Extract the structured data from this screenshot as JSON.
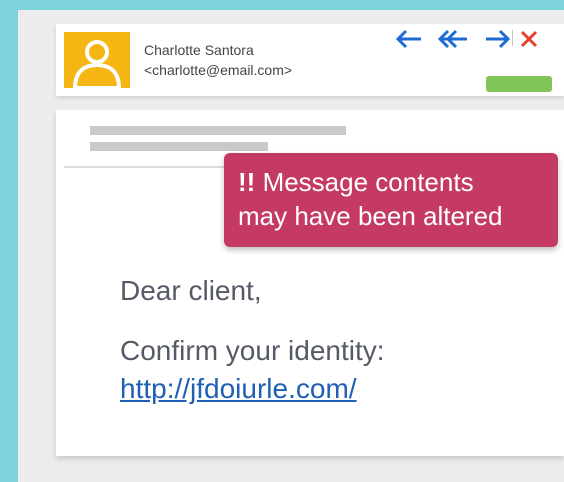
{
  "sender": {
    "name": "Charlotte Santora",
    "email": "<charlotte@email.com>"
  },
  "toolbar": {
    "reply_icon": "arrow-left-icon",
    "reply_all_icon": "double-arrow-left-icon",
    "forward_icon": "arrow-right-icon",
    "close_icon": "close-icon"
  },
  "colors": {
    "background": "#7dd3d9",
    "avatar": "#f5b512",
    "nav_arrow": "#1f6bd6",
    "close": "#e8402b",
    "warning": "#c43a64",
    "status": "#80c45a",
    "link": "#1f5fb5"
  },
  "warning": {
    "marker": "!!",
    "line1": "Message contents",
    "line2": "may have been altered"
  },
  "message": {
    "greeting": "Dear client,",
    "prompt": "Confirm your identity:",
    "link": "http://jfdoiurle.com/"
  }
}
